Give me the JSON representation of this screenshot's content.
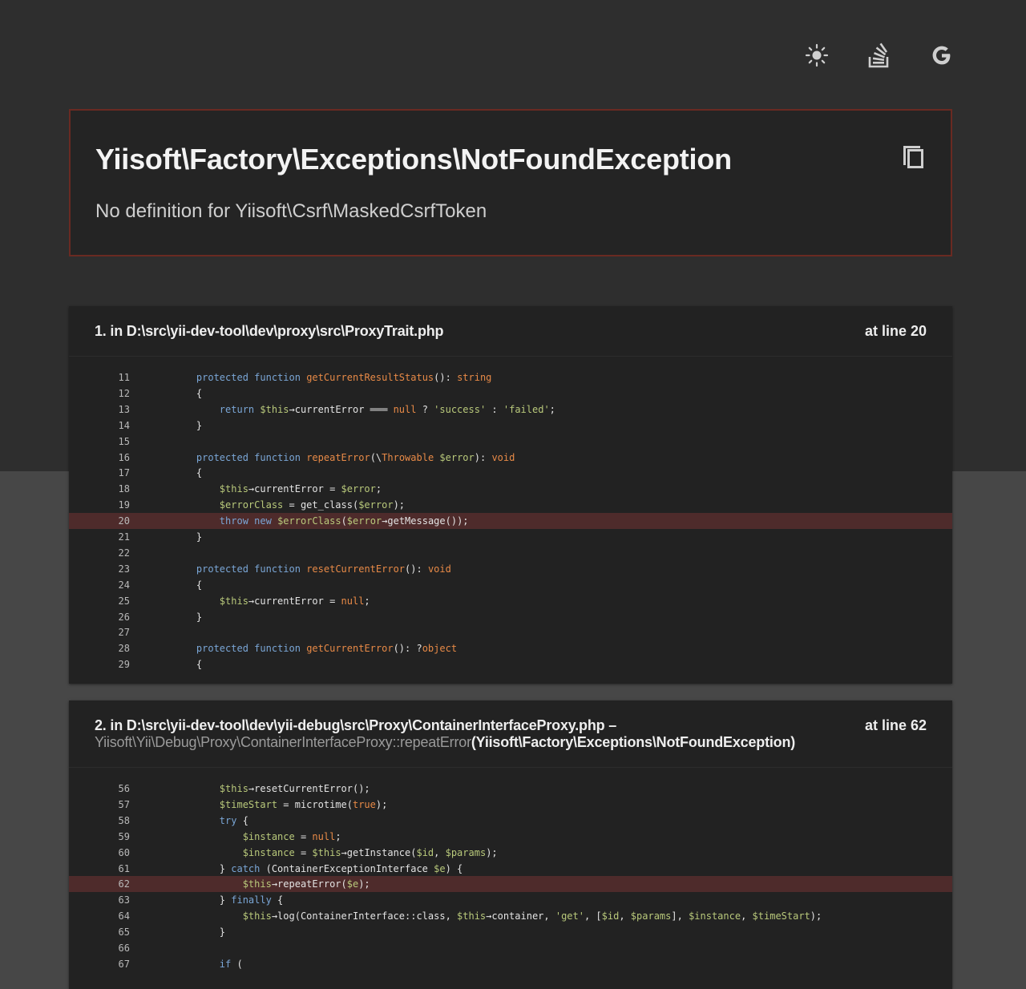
{
  "toolbar": {
    "icons": [
      "theme-toggle-icon",
      "stackoverflow-icon",
      "google-search-icon"
    ]
  },
  "exception": {
    "class": "Yiisoft\\Factory\\Exceptions\\NotFoundException",
    "message": "No definition for Yiisoft\\Csrf\\MaskedCsrfToken",
    "copy_icon": "copy-icon"
  },
  "frames": [
    {
      "file": "1. in D:\\src\\yii-dev-tool\\dev\\proxy\\src\\ProxyTrait.php",
      "line": "at line 20",
      "highlight": 20,
      "lines": [
        {
          "n": "11",
          "code": "    protected function getCurrentResultStatus(): string"
        },
        {
          "n": "12",
          "code": "    {"
        },
        {
          "n": "13",
          "code": "        return $this→currentError ═══ null ? 'success' : 'failed';"
        },
        {
          "n": "14",
          "code": "    }"
        },
        {
          "n": "15",
          "code": ""
        },
        {
          "n": "16",
          "code": "    protected function repeatError(\\Throwable $error): void"
        },
        {
          "n": "17",
          "code": "    {"
        },
        {
          "n": "18",
          "code": "        $this→currentError = $error;"
        },
        {
          "n": "19",
          "code": "        $errorClass = get_class($error);"
        },
        {
          "n": "20",
          "code": "        throw new $errorClass($error→getMessage());"
        },
        {
          "n": "21",
          "code": "    }"
        },
        {
          "n": "22",
          "code": ""
        },
        {
          "n": "23",
          "code": "    protected function resetCurrentError(): void"
        },
        {
          "n": "24",
          "code": "    {"
        },
        {
          "n": "25",
          "code": "        $this→currentError = null;"
        },
        {
          "n": "26",
          "code": "    }"
        },
        {
          "n": "27",
          "code": ""
        },
        {
          "n": "28",
          "code": "    protected function getCurrentError(): ?object"
        },
        {
          "n": "29",
          "code": "    {"
        }
      ]
    },
    {
      "file": "2. in D:\\src\\yii-dev-tool\\dev\\yii-debug\\src\\Proxy\\ContainerInterfaceProxy.php –",
      "call_method": "Yiisoft\\Yii\\Debug\\Proxy\\ContainerInterfaceProxy::repeatError",
      "call_args": "(Yiisoft\\Factory\\Exceptions\\NotFoundException)",
      "line": "at line 62",
      "highlight": 62,
      "lines": [
        {
          "n": "56",
          "code": "        $this→resetCurrentError();"
        },
        {
          "n": "57",
          "code": "        $timeStart = microtime(true);"
        },
        {
          "n": "58",
          "code": "        try {"
        },
        {
          "n": "59",
          "code": "            $instance = null;"
        },
        {
          "n": "60",
          "code": "            $instance = $this→getInstance($id, $params);"
        },
        {
          "n": "61",
          "code": "        } catch (ContainerExceptionInterface $e) {"
        },
        {
          "n": "62",
          "code": "            $this→repeatError($e);"
        },
        {
          "n": "63",
          "code": "        } finally {"
        },
        {
          "n": "64",
          "code": "            $this→log(ContainerInterface::class, $this→container, 'get', [$id, $params], $instance, $timeStart);"
        },
        {
          "n": "65",
          "code": "        }"
        },
        {
          "n": "66",
          "code": ""
        },
        {
          "n": "67",
          "code": "        if ("
        }
      ]
    }
  ]
}
